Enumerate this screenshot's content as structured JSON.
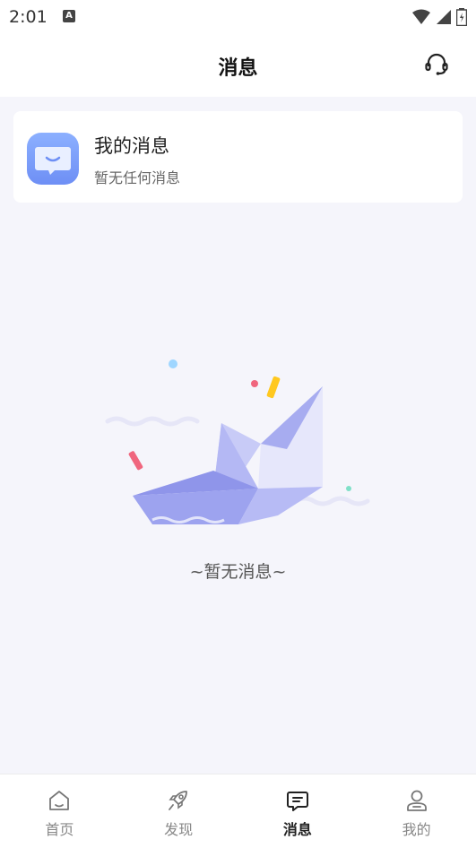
{
  "status_bar": {
    "time": "2:01",
    "notif_icon": "A"
  },
  "header": {
    "title": "消息",
    "support_icon": "headset-icon"
  },
  "message_card": {
    "title": "我的消息",
    "subtitle": "暂无任何消息",
    "icon": "message-box-icon",
    "icon_color": "#7ea0ff"
  },
  "empty_state": {
    "text": "~暂无消息~",
    "illustration": "paper-boat-illustration"
  },
  "tabbar": {
    "items": [
      {
        "label": "首页",
        "icon": "home-icon",
        "active": false
      },
      {
        "label": "发现",
        "icon": "rocket-icon",
        "active": false
      },
      {
        "label": "消息",
        "icon": "chat-icon",
        "active": true
      },
      {
        "label": "我的",
        "icon": "user-icon",
        "active": false
      }
    ]
  },
  "colors": {
    "accent": "#7ea0ff",
    "background": "#f5f5fb",
    "boat": "#9fa6f0"
  }
}
